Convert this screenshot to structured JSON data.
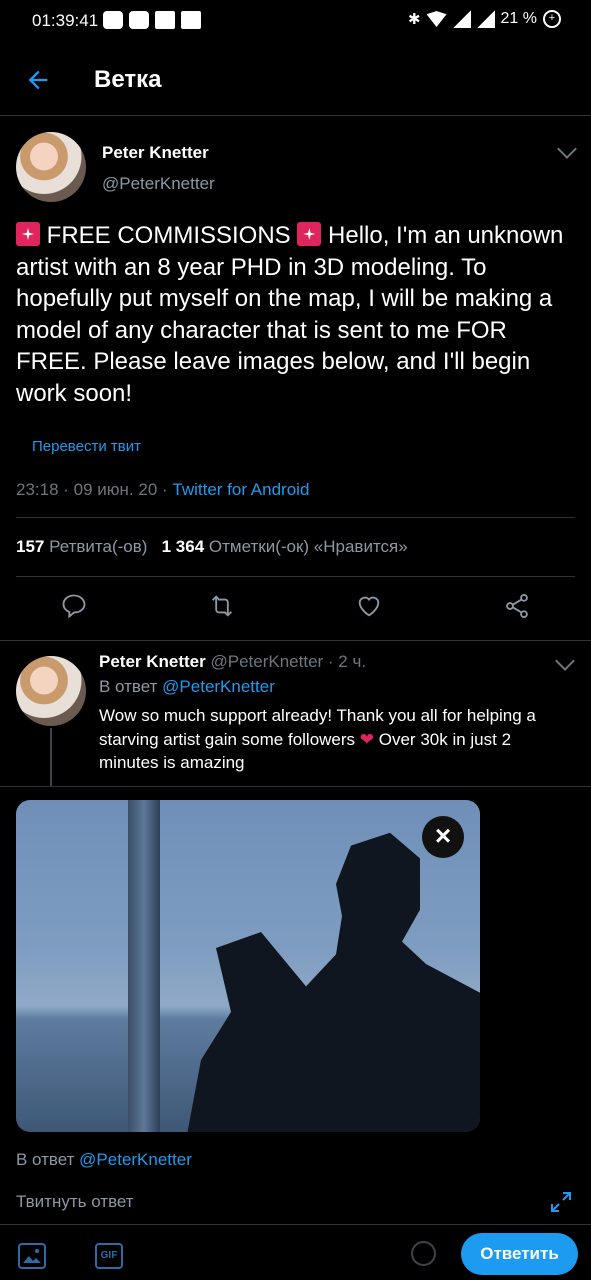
{
  "status_bar": {
    "time": "01:39:41",
    "battery": "21 %"
  },
  "header": {
    "title": "Ветка"
  },
  "tweet": {
    "name": "Peter Knetter",
    "handle": "@PeterKnetter",
    "text_part1": " FREE COMMISSIONS ",
    "text_part2": " Hello, I'm an unknown artist with an 8 year PHD in 3D modeling. To hopefully put myself on the map, I will be making a model of any character that is sent to me FOR FREE. Please leave images below, and I'll begin work soon!",
    "translate": "Перевести твит",
    "time": "23:18 · 09 июн. 20 · ",
    "source": "Twitter for Android",
    "retweets_count": "157",
    "retweets_label": "Ретвита(-ов)",
    "likes_count": "1 364",
    "likes_label": "Отметки(-ок) «Нравится»"
  },
  "reply": {
    "name": "Peter Knetter",
    "handle_time": "@PeterKnetter · 2 ч.",
    "reply_to_label": "В ответ ",
    "reply_to_handle": "@PeterKnetter",
    "text_part1": "Wow so much support already! Thank you all for helping a starving artist gain some followers ",
    "text_part2": " Over 30k in just 2 minutes is amazing"
  },
  "composer": {
    "reply_to_label": "В ответ ",
    "reply_to_handle": "@PeterKnetter",
    "placeholder": "Твитнуть ответ",
    "gif_label": "GIF",
    "send_label": "Ответить"
  },
  "colors": {
    "accent": "#1d9bf0",
    "background": "#000000",
    "heart": "#e0245e"
  }
}
